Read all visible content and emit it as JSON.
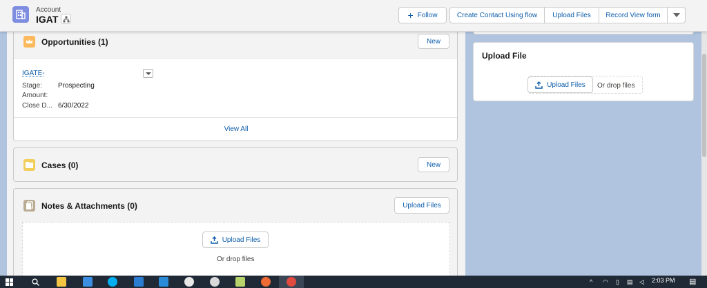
{
  "header": {
    "object_label": "Account",
    "record_name": "IGAT",
    "buttons": {
      "follow": "Follow",
      "create_contact": "Create Contact Using flow",
      "upload_files": "Upload Files",
      "record_view_form": "Record View form"
    }
  },
  "opportunities": {
    "title": "Opportunities (1)",
    "new_label": "New",
    "record": {
      "name": "IGATE-",
      "stage_label": "Stage:",
      "stage_value": "Prospecting",
      "amount_label": "Amount:",
      "amount_value": "",
      "close_label": "Close D...",
      "close_value": "6/30/2022"
    },
    "view_all": "View All"
  },
  "cases": {
    "title": "Cases (0)",
    "new_label": "New"
  },
  "notes": {
    "title": "Notes & Attachments (0)",
    "upload_label": "Upload Files",
    "drop_upload_label": "Upload Files",
    "or_drop": "Or drop files"
  },
  "upload_file_card": {
    "title": "Upload File",
    "upload_label": "Upload Files",
    "or_drop": "Or drop files"
  },
  "taskbar": {
    "time": "2:03 PM",
    "date": ""
  },
  "colors": {
    "brand_blue": "#0b5cab",
    "account_icon": "#7f8de1",
    "opportunity_icon": "#fcb95b",
    "case_icon": "#f2cf5b",
    "notes_icon": "#baac93",
    "page_background": "#b0c4df"
  }
}
